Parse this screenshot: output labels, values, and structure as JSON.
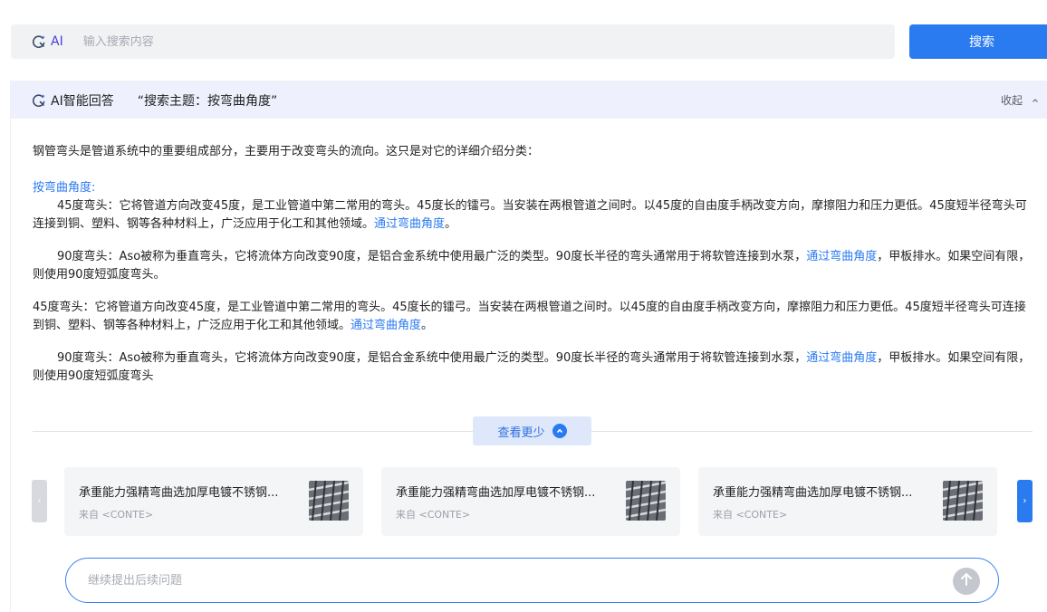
{
  "search": {
    "ai_label": "AI",
    "placeholder": "输入搜索内容",
    "button_label": "搜索"
  },
  "answer": {
    "header_title": "AI智能回答",
    "topic": "“搜索主题：按弯曲角度”",
    "collapse_label": "收起",
    "intro": "钢管弯头是管道系统中的重要组成部分，主要用于改变弯头的流向。这只是对它的详细介绍分类：",
    "category_title": "按弯曲角度:",
    "paragraphs": [
      {
        "text": "45度弯头：它将管道方向改变45度，是工业管道中第二常用的弯头。45度长的镭弓。当安装在两根管道之间时。以45度的自由度手柄改变方向，摩擦阻力和压力更低。45度短半径弯头可连接到铜、塑料、钢等各种材料上，广泛应用于化工和其他领域。",
        "link": "通过弯曲角度",
        "after": "。"
      },
      {
        "text": "90度弯头：Aso被称为垂直弯头，它将流体方向改变90度，是铝合金系统中使用最广泛的类型。90度长半径的弯头通常用于将软管连接到水泵，",
        "link": "通过弯曲角度",
        "after": "，甲板排水。如果空间有限，则使用90度短弧度弯头。"
      },
      {
        "text": "45度弯头：它将管道方向改变45度，是工业管道中第二常用的弯头。45度长的镭弓。当安装在两根管道之间时。以45度的自由度手柄改变方向，摩擦阻力和压力更低。45度短半径弯头可连接到铜、塑料、钢等各种材料上，广泛应用于化工和其他领域。",
        "link": "通过弯曲角度",
        "after": "。"
      },
      {
        "text": "90度弯头：Aso被称为垂直弯头，它将流体方向改变90度，是铝合金系统中使用最广泛的类型。90度长半径的弯头通常用于将软管连接到水泵，",
        "link": "通过弯曲角度",
        "after": "，甲板排水。如果空间有限，则使用90度短弧度弯头"
      }
    ],
    "see_less_label": "查看更少"
  },
  "carousel": {
    "cards": [
      {
        "title": "承重能力强精弯曲选加厚电镀不锈钢...",
        "source": "来自 <CONTE>"
      },
      {
        "title": "承重能力强精弯曲选加厚电镀不锈钢...",
        "source": "来自 <CONTE>"
      },
      {
        "title": "承重能力强精弯曲选加厚电镀不锈钢...",
        "source": "来自 <CONTE>"
      }
    ],
    "prev_icon": "chevron-left-icon",
    "next_icon": "chevron-right-icon"
  },
  "followup": {
    "placeholder": "继续提出后续问题"
  },
  "colors": {
    "accent": "#2b7bf0",
    "header_bg": "#eef1fd",
    "search_bg": "#f1f2f4"
  }
}
